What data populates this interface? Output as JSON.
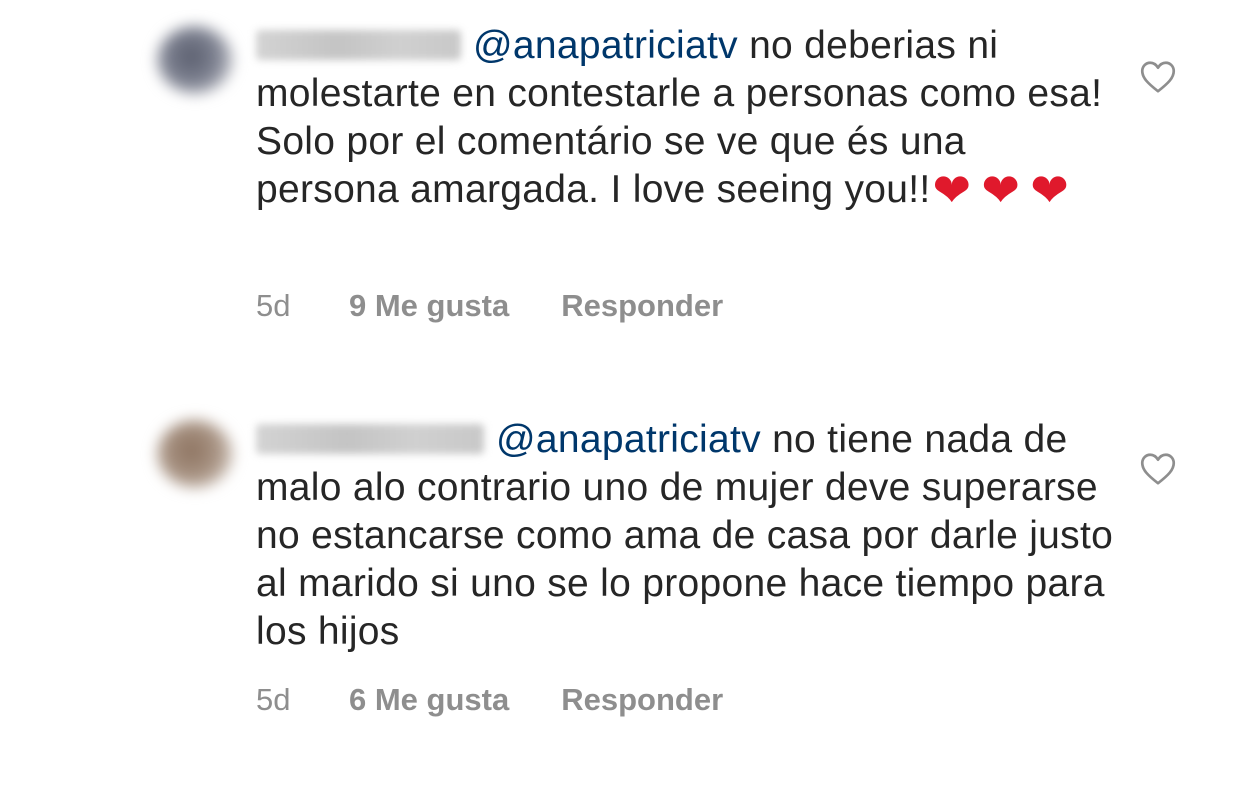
{
  "comments": [
    {
      "text": "no deberias ni molestarte en contestarle a personas como esa! Solo por el comentário se ve que és una persona amargada. I love seeing you!!",
      "mention": "@anapatriciatv",
      "hearts": [
        "❤",
        "❤",
        "❤"
      ],
      "time": "5d",
      "likes": "9 Me gusta",
      "reply": "Responder"
    },
    {
      "text": "no tiene nada de malo alo contrario uno de mujer deve superarse no estancarse como ama de casa por darle justo al marido si uno se lo propone hace tiempo para los hijos",
      "mention": "@anapatriciatv",
      "hearts": [],
      "time": "5d",
      "likes": "6 Me gusta",
      "reply": "Responder"
    }
  ],
  "colors": {
    "mention": "#00376b",
    "text": "#262626",
    "meta": "#8e8e8e",
    "heart_emoji": "#e0192c"
  },
  "icons": {
    "like": "heart-outline-icon"
  }
}
